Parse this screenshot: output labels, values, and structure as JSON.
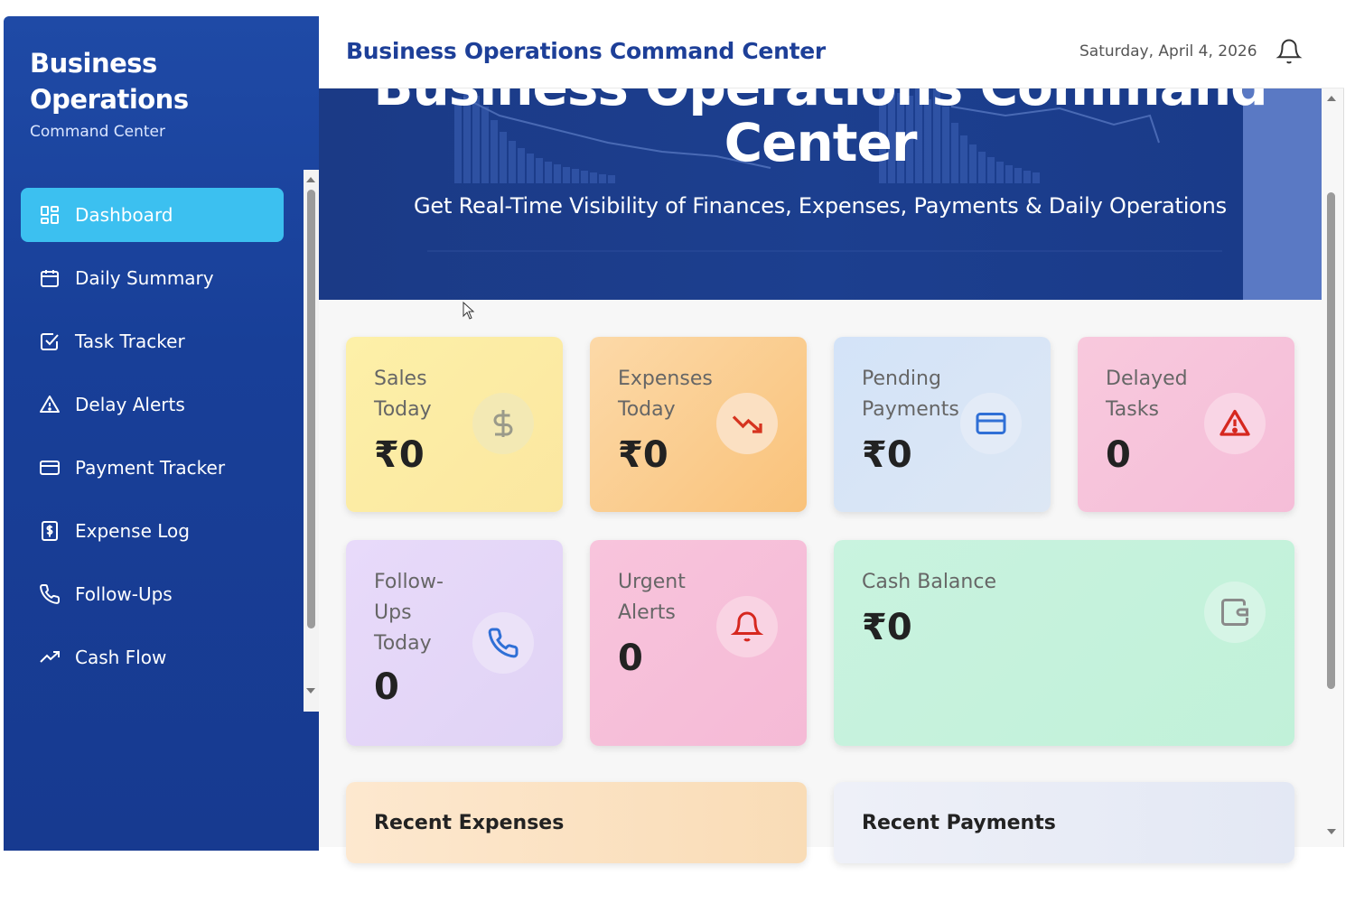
{
  "sidebar": {
    "brand_title": "Business Operations",
    "brand_subtitle": "Command Center",
    "items": [
      {
        "label": "Dashboard",
        "icon": "grid-icon",
        "active": true
      },
      {
        "label": "Daily Summary",
        "icon": "calendar-icon",
        "active": false
      },
      {
        "label": "Task Tracker",
        "icon": "checkbox-icon",
        "active": false
      },
      {
        "label": "Delay Alerts",
        "icon": "warning-icon",
        "active": false
      },
      {
        "label": "Payment Tracker",
        "icon": "credit-card-icon",
        "active": false
      },
      {
        "label": "Expense Log",
        "icon": "dollar-receipt-icon",
        "active": false
      },
      {
        "label": "Follow-Ups",
        "icon": "phone-icon",
        "active": false
      },
      {
        "label": "Cash Flow",
        "icon": "trend-up-icon",
        "active": false
      }
    ]
  },
  "header": {
    "title": "Business Operations Command Center",
    "date": "Saturday, April 4, 2026"
  },
  "hero": {
    "title_line1": "Business Operations Command",
    "title_line2": "Center",
    "subtitle": "Get Real-Time Visibility of Finances, Expenses, Payments & Daily Operations"
  },
  "cards": {
    "sales": {
      "label_line1": "Sales",
      "label_line2": "Today",
      "value": "₹0"
    },
    "expenses": {
      "label_line1": "Expenses",
      "label_line2": "Today",
      "value": "₹0"
    },
    "pending": {
      "label_line1": "Pending",
      "label_line2": "Payments",
      "value": "₹0"
    },
    "delayed": {
      "label_line1": "Delayed",
      "label_line2": "Tasks",
      "value": "0"
    },
    "followups": {
      "label_line1": "Follow-",
      "label_line2": "Ups",
      "label_line3": "Today",
      "value": "0"
    },
    "urgent": {
      "label_line1": "Urgent",
      "label_line2": "Alerts",
      "value": "0"
    },
    "cash": {
      "label": "Cash Balance",
      "value": "₹0"
    }
  },
  "sections": {
    "recent_expenses": "Recent Expenses",
    "recent_payments": "Recent Payments"
  },
  "colors": {
    "sidebar_bg": "#1f4aa6",
    "active_item": "#3cc0f0",
    "title_blue": "#1d3f98"
  }
}
